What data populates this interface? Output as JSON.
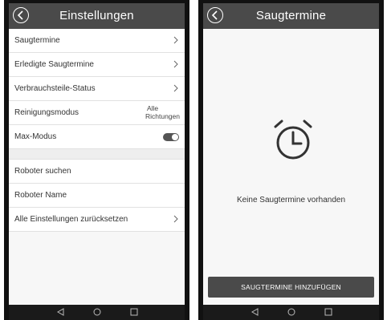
{
  "settings_screen": {
    "title": "Einstellungen",
    "items": [
      {
        "label": "Saugtermine"
      },
      {
        "label": "Erledigte Saugtermine"
      },
      {
        "label": "Verbrauchsteile-Status"
      },
      {
        "label": "Reinigungsmodus",
        "value_line1": "Alle",
        "value_line2": "Richtungen"
      },
      {
        "label": "Max-Modus",
        "toggle_on": true
      }
    ],
    "items2": [
      {
        "label": "Roboter suchen"
      },
      {
        "label": "Roboter Name"
      },
      {
        "label": "Alle Einstellungen zurücksetzen"
      }
    ]
  },
  "schedule_screen": {
    "title": "Saugtermine",
    "empty_message": "Keine Saugtermine vorhanden",
    "add_button_label": "SAUGTERMINE HINZUFÜGEN"
  },
  "icons": {
    "back": "back-arrow-circle-icon",
    "chevron": "chevron-right-icon",
    "alarm": "alarm-clock-icon",
    "nav_back": "triangle-back-icon",
    "nav_home": "circle-home-icon",
    "nav_recent": "square-recent-icon"
  },
  "colors": {
    "header_bg": "#4a4a4a",
    "button_bg": "#4a4a4a",
    "toggle_on": "#555555"
  }
}
